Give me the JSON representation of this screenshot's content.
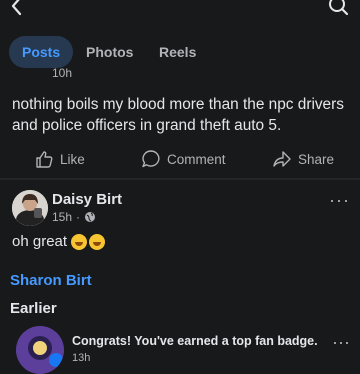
{
  "header": {
    "back_icon": "chevron-left-icon",
    "search_icon": "search-icon"
  },
  "tabs": [
    {
      "label": "Posts",
      "active": true
    },
    {
      "label": "Photos",
      "active": false
    },
    {
      "label": "Reels",
      "active": false
    }
  ],
  "post": {
    "timestamp": "10h",
    "text": "nothing boils my blood more than the npc drivers and police officers in grand theft auto 5.",
    "actions": {
      "like": "Like",
      "comment": "Comment",
      "share": "Share"
    }
  },
  "comment": {
    "author": "Daisy Birt",
    "time": "15h",
    "text": "oh great",
    "emoji": [
      "rolling-on-floor-laughing-emoji",
      "rolling-on-floor-laughing-emoji"
    ]
  },
  "reply_link": "Sharon Birt",
  "section_label": "Earlier",
  "notification": {
    "text": "Congrats! You've earned a top fan badge.",
    "time": "13h"
  },
  "colors": {
    "background": "#18191a",
    "accent": "#4599ff",
    "active_tab_bg": "#263951",
    "secondary_text": "#b0b3b8"
  }
}
